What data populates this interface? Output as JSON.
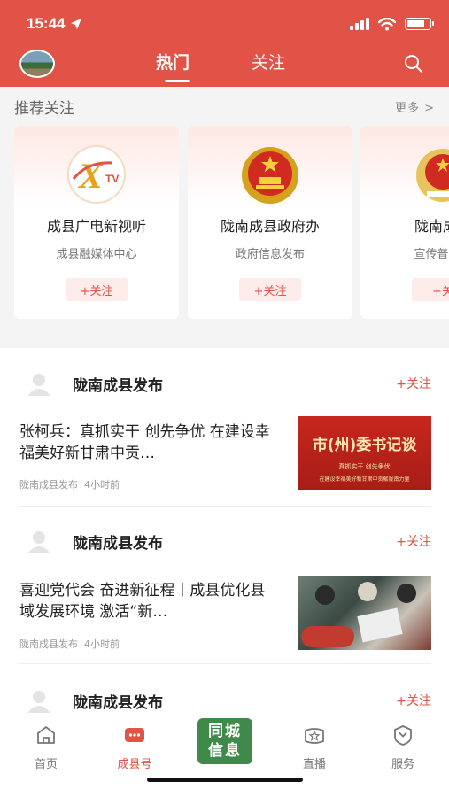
{
  "status": {
    "time": "15:44"
  },
  "nav": {
    "tabs": [
      {
        "label": "热门"
      },
      {
        "label": "关注"
      }
    ]
  },
  "recommend": {
    "title": "推荐关注",
    "more": "更多 >",
    "cards": [
      {
        "name": "成县广电新视听",
        "desc": "成县融媒体中心",
        "follow": "+关注"
      },
      {
        "name": "陇南成县政府办",
        "desc": "政府信息发布",
        "follow": "+关注"
      },
      {
        "name": "陇南成县",
        "desc": "宣传普及以",
        "follow": "+关"
      }
    ]
  },
  "feed": [
    {
      "publisher": "陇南成县发布",
      "follow": "+关注",
      "title": "张柯兵：真抓实干 创先争优 在建设幸福美好新甘肃中贡…",
      "source": "陇南成县发布",
      "time": "4小时前",
      "image_text": "市(州)委书记谈",
      "image_sub": "真抓实干  创先争优",
      "image_sub2": "在建设幸福美好新甘肃中贡献陇南力量"
    },
    {
      "publisher": "陇南成县发布",
      "follow": "+关注",
      "title": "喜迎党代会 奋进新征程丨成县优化县域发展环境 激活“新…",
      "source": "陇南成县发布",
      "time": "4小时前"
    },
    {
      "publisher": "陇南成县发布",
      "follow": "+关注"
    }
  ],
  "bottom_nav": [
    {
      "label": "首页",
      "icon": "home-icon"
    },
    {
      "label": "成县号",
      "icon": "chat-icon"
    },
    {
      "label": "同城信息",
      "line1": "同城",
      "line2": "信息"
    },
    {
      "label": "直播",
      "icon": "live-icon"
    },
    {
      "label": "服务",
      "icon": "service-icon"
    }
  ],
  "colors": {
    "brand_red": "#e05346",
    "center_green": "#3f8a4a"
  }
}
